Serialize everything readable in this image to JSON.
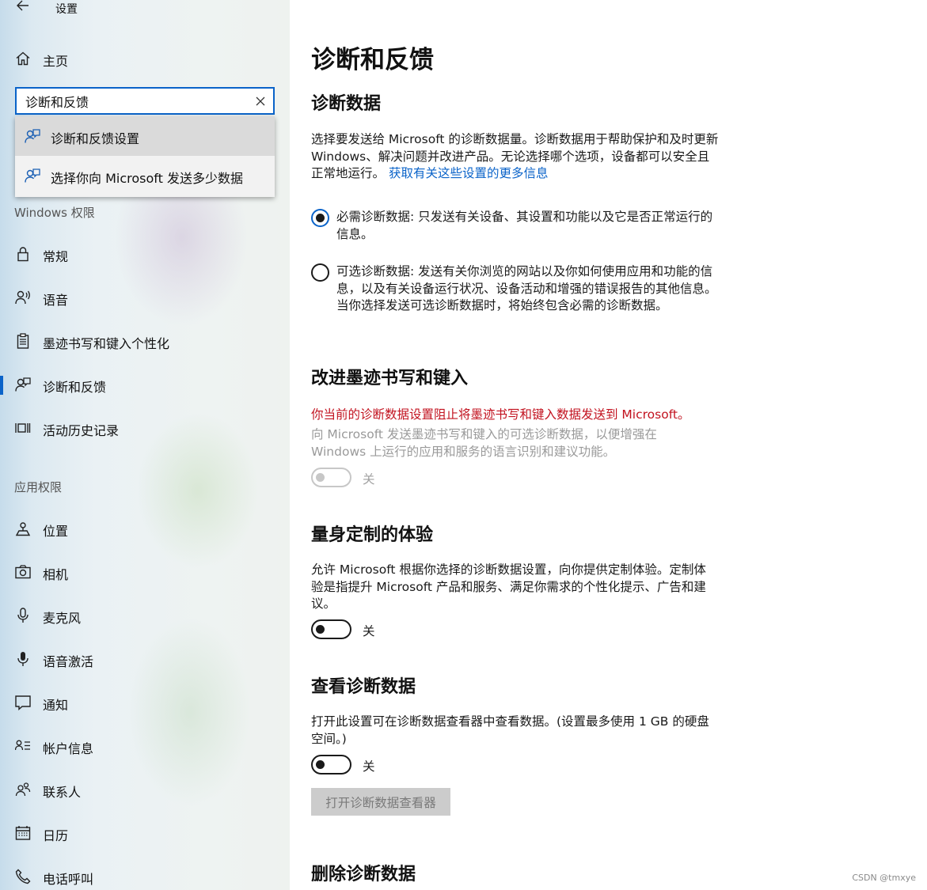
{
  "app": {
    "title": "设置"
  },
  "sidebar": {
    "home": {
      "label": "主页",
      "icon": "home-icon"
    },
    "search": {
      "value": "诊断和反馈",
      "placeholder": ""
    },
    "suggestions": [
      {
        "label": "诊断和反馈设置",
        "icon": "feedback-icon"
      },
      {
        "label": "选择你向 Microsoft 发送多少数据",
        "icon": "feedback-icon"
      }
    ],
    "windows_section": {
      "title": "Windows 权限"
    },
    "windows_items": [
      {
        "label": "常规",
        "icon": "lock-icon"
      },
      {
        "label": "语音",
        "icon": "speech-icon"
      },
      {
        "label": "墨迹书写和键入个性化",
        "icon": "clipboard-icon"
      },
      {
        "label": "诊断和反馈",
        "icon": "feedback-icon",
        "selected": true
      },
      {
        "label": "活动历史记录",
        "icon": "activity-icon"
      }
    ],
    "app_section": {
      "title": "应用权限"
    },
    "app_items": [
      {
        "label": "位置",
        "icon": "location-icon"
      },
      {
        "label": "相机",
        "icon": "camera-icon"
      },
      {
        "label": "麦克风",
        "icon": "microphone-icon"
      },
      {
        "label": "语音激活",
        "icon": "voice-activation-icon"
      },
      {
        "label": "通知",
        "icon": "notification-icon"
      },
      {
        "label": "帐户信息",
        "icon": "account-info-icon"
      },
      {
        "label": "联系人",
        "icon": "contacts-icon"
      },
      {
        "label": "日历",
        "icon": "calendar-icon"
      },
      {
        "label": "电话呼叫",
        "icon": "phone-icon"
      }
    ]
  },
  "main": {
    "title": "诊断和反馈",
    "diag": {
      "heading": "诊断数据",
      "desc": "选择要发送给 Microsoft 的诊断数据量。诊断数据用于帮助保护和及时更新 Windows、解决问题并改进产品。无论选择哪个选项，设备都可以安全且正常地运行。",
      "link": "获取有关这些设置的更多信息",
      "options": [
        {
          "text": "必需诊断数据: 只发送有关设备、其设置和功能以及它是否正常运行的信息。",
          "checked": true
        },
        {
          "text": "可选诊断数据: 发送有关你浏览的网站以及你如何使用应用和功能的信息，以及有关设备运行状况、设备活动和增强的错误报告的其他信息。当你选择发送可选诊断数据时，将始终包含必需的诊断数据。",
          "checked": false
        }
      ]
    },
    "inking": {
      "heading": "改进墨迹书写和键入",
      "warning": "你当前的诊断数据设置阻止将墨迹书写和键入数据发送到 Microsoft。",
      "desc": "向 Microsoft 发送墨迹书写和键入的可选诊断数据，以便增强在 Windows 上运行的应用和服务的语言识别和建议功能。",
      "toggle_label": "关",
      "toggle_on": false,
      "toggle_disabled": true
    },
    "tailored": {
      "heading": "量身定制的体验",
      "desc": "允许 Microsoft 根据你选择的诊断数据设置，向你提供定制体验。定制体验是指提升 Microsoft 产品和服务、满足你需求的个性化提示、广告和建议。",
      "toggle_label": "关",
      "toggle_on": false
    },
    "view": {
      "heading": "查看诊断数据",
      "desc": "打开此设置可在诊断数据查看器中查看数据。(设置最多使用 1 GB 的硬盘空间。)",
      "toggle_label": "关",
      "toggle_on": false,
      "button": "打开诊断数据查看器"
    },
    "delete": {
      "heading": "删除诊断数据"
    }
  },
  "watermark": "CSDN @tmxye",
  "colors": {
    "accent": "#0a63c9",
    "warning": "#c2121f",
    "muted": "#9a9a9a"
  }
}
